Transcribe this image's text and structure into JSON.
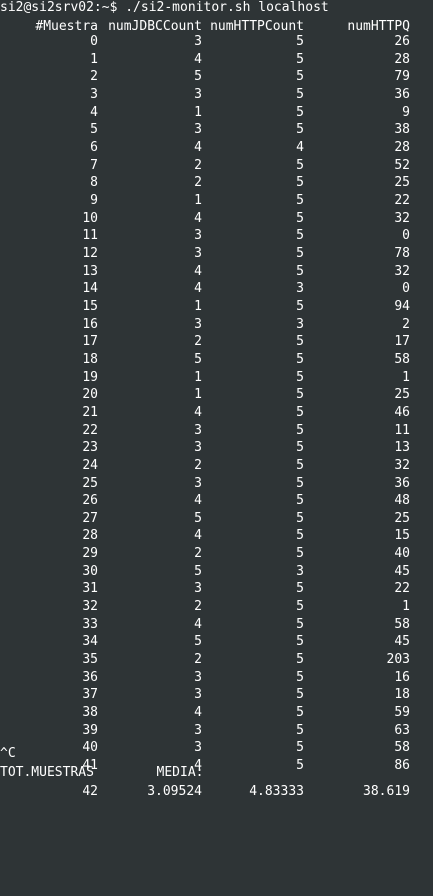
{
  "prompt": "si2@si2srv02:~$ ./si2-monitor.sh localhost",
  "headers": [
    "#Muestra",
    "numJDBCCount",
    "numHTTPCount",
    "numHTTPQ"
  ],
  "rows": [
    [
      "0",
      "3",
      "5",
      "26"
    ],
    [
      "1",
      "4",
      "5",
      "28"
    ],
    [
      "2",
      "5",
      "5",
      "79"
    ],
    [
      "3",
      "3",
      "5",
      "36"
    ],
    [
      "4",
      "1",
      "5",
      "9"
    ],
    [
      "5",
      "3",
      "5",
      "38"
    ],
    [
      "6",
      "4",
      "4",
      "28"
    ],
    [
      "7",
      "2",
      "5",
      "52"
    ],
    [
      "8",
      "2",
      "5",
      "25"
    ],
    [
      "9",
      "1",
      "5",
      "22"
    ],
    [
      "10",
      "4",
      "5",
      "32"
    ],
    [
      "11",
      "3",
      "5",
      "0"
    ],
    [
      "12",
      "3",
      "5",
      "78"
    ],
    [
      "13",
      "4",
      "5",
      "32"
    ],
    [
      "14",
      "4",
      "3",
      "0"
    ],
    [
      "15",
      "1",
      "5",
      "94"
    ],
    [
      "16",
      "3",
      "3",
      "2"
    ],
    [
      "17",
      "2",
      "5",
      "17"
    ],
    [
      "18",
      "5",
      "5",
      "58"
    ],
    [
      "19",
      "1",
      "5",
      "1"
    ],
    [
      "20",
      "1",
      "5",
      "25"
    ],
    [
      "21",
      "4",
      "5",
      "46"
    ],
    [
      "22",
      "3",
      "5",
      "11"
    ],
    [
      "23",
      "3",
      "5",
      "13"
    ],
    [
      "24",
      "2",
      "5",
      "32"
    ],
    [
      "25",
      "3",
      "5",
      "36"
    ],
    [
      "26",
      "4",
      "5",
      "48"
    ],
    [
      "27",
      "5",
      "5",
      "25"
    ],
    [
      "28",
      "4",
      "5",
      "15"
    ],
    [
      "29",
      "2",
      "5",
      "40"
    ],
    [
      "30",
      "5",
      "3",
      "45"
    ],
    [
      "31",
      "3",
      "5",
      "22"
    ],
    [
      "32",
      "2",
      "5",
      "1"
    ],
    [
      "33",
      "4",
      "5",
      "58"
    ],
    [
      "34",
      "5",
      "5",
      "45"
    ],
    [
      "35",
      "2",
      "5",
      "203"
    ],
    [
      "36",
      "3",
      "5",
      "16"
    ],
    [
      "37",
      "3",
      "5",
      "18"
    ],
    [
      "38",
      "4",
      "5",
      "59"
    ],
    [
      "39",
      "3",
      "5",
      "63"
    ],
    [
      "40",
      "3",
      "5",
      "58"
    ],
    [
      "41",
      "4",
      "5",
      "86"
    ]
  ],
  "interrupt": "^C",
  "summary_header": "TOT.MUESTRAS        MEDIA:",
  "summary_values": [
    "42",
    "3.09524",
    "4.83333",
    "38.619"
  ]
}
